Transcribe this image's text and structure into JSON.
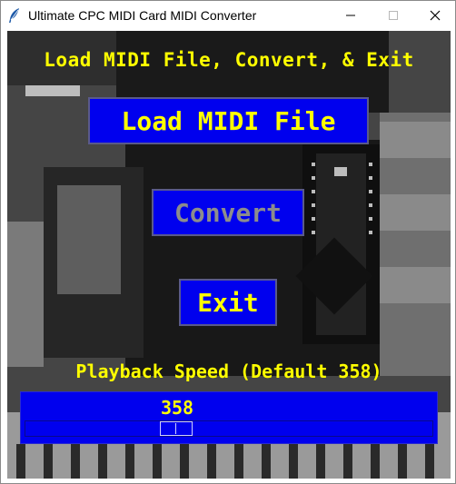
{
  "window": {
    "title": "Ultimate CPC MIDI Card MIDI Converter",
    "icon": "feather-icon"
  },
  "heading": "Load MIDI File, Convert, & Exit",
  "buttons": {
    "load": "Load MIDI File",
    "convert": "Convert",
    "exit": "Exit"
  },
  "playback": {
    "label": "Playback Speed (Default 358)",
    "value": "358",
    "slider_fraction": 0.36
  },
  "colors": {
    "panel_blue": "#0000ee",
    "text_yellow": "#ffff00",
    "disabled_gray": "#8c8c8c"
  }
}
